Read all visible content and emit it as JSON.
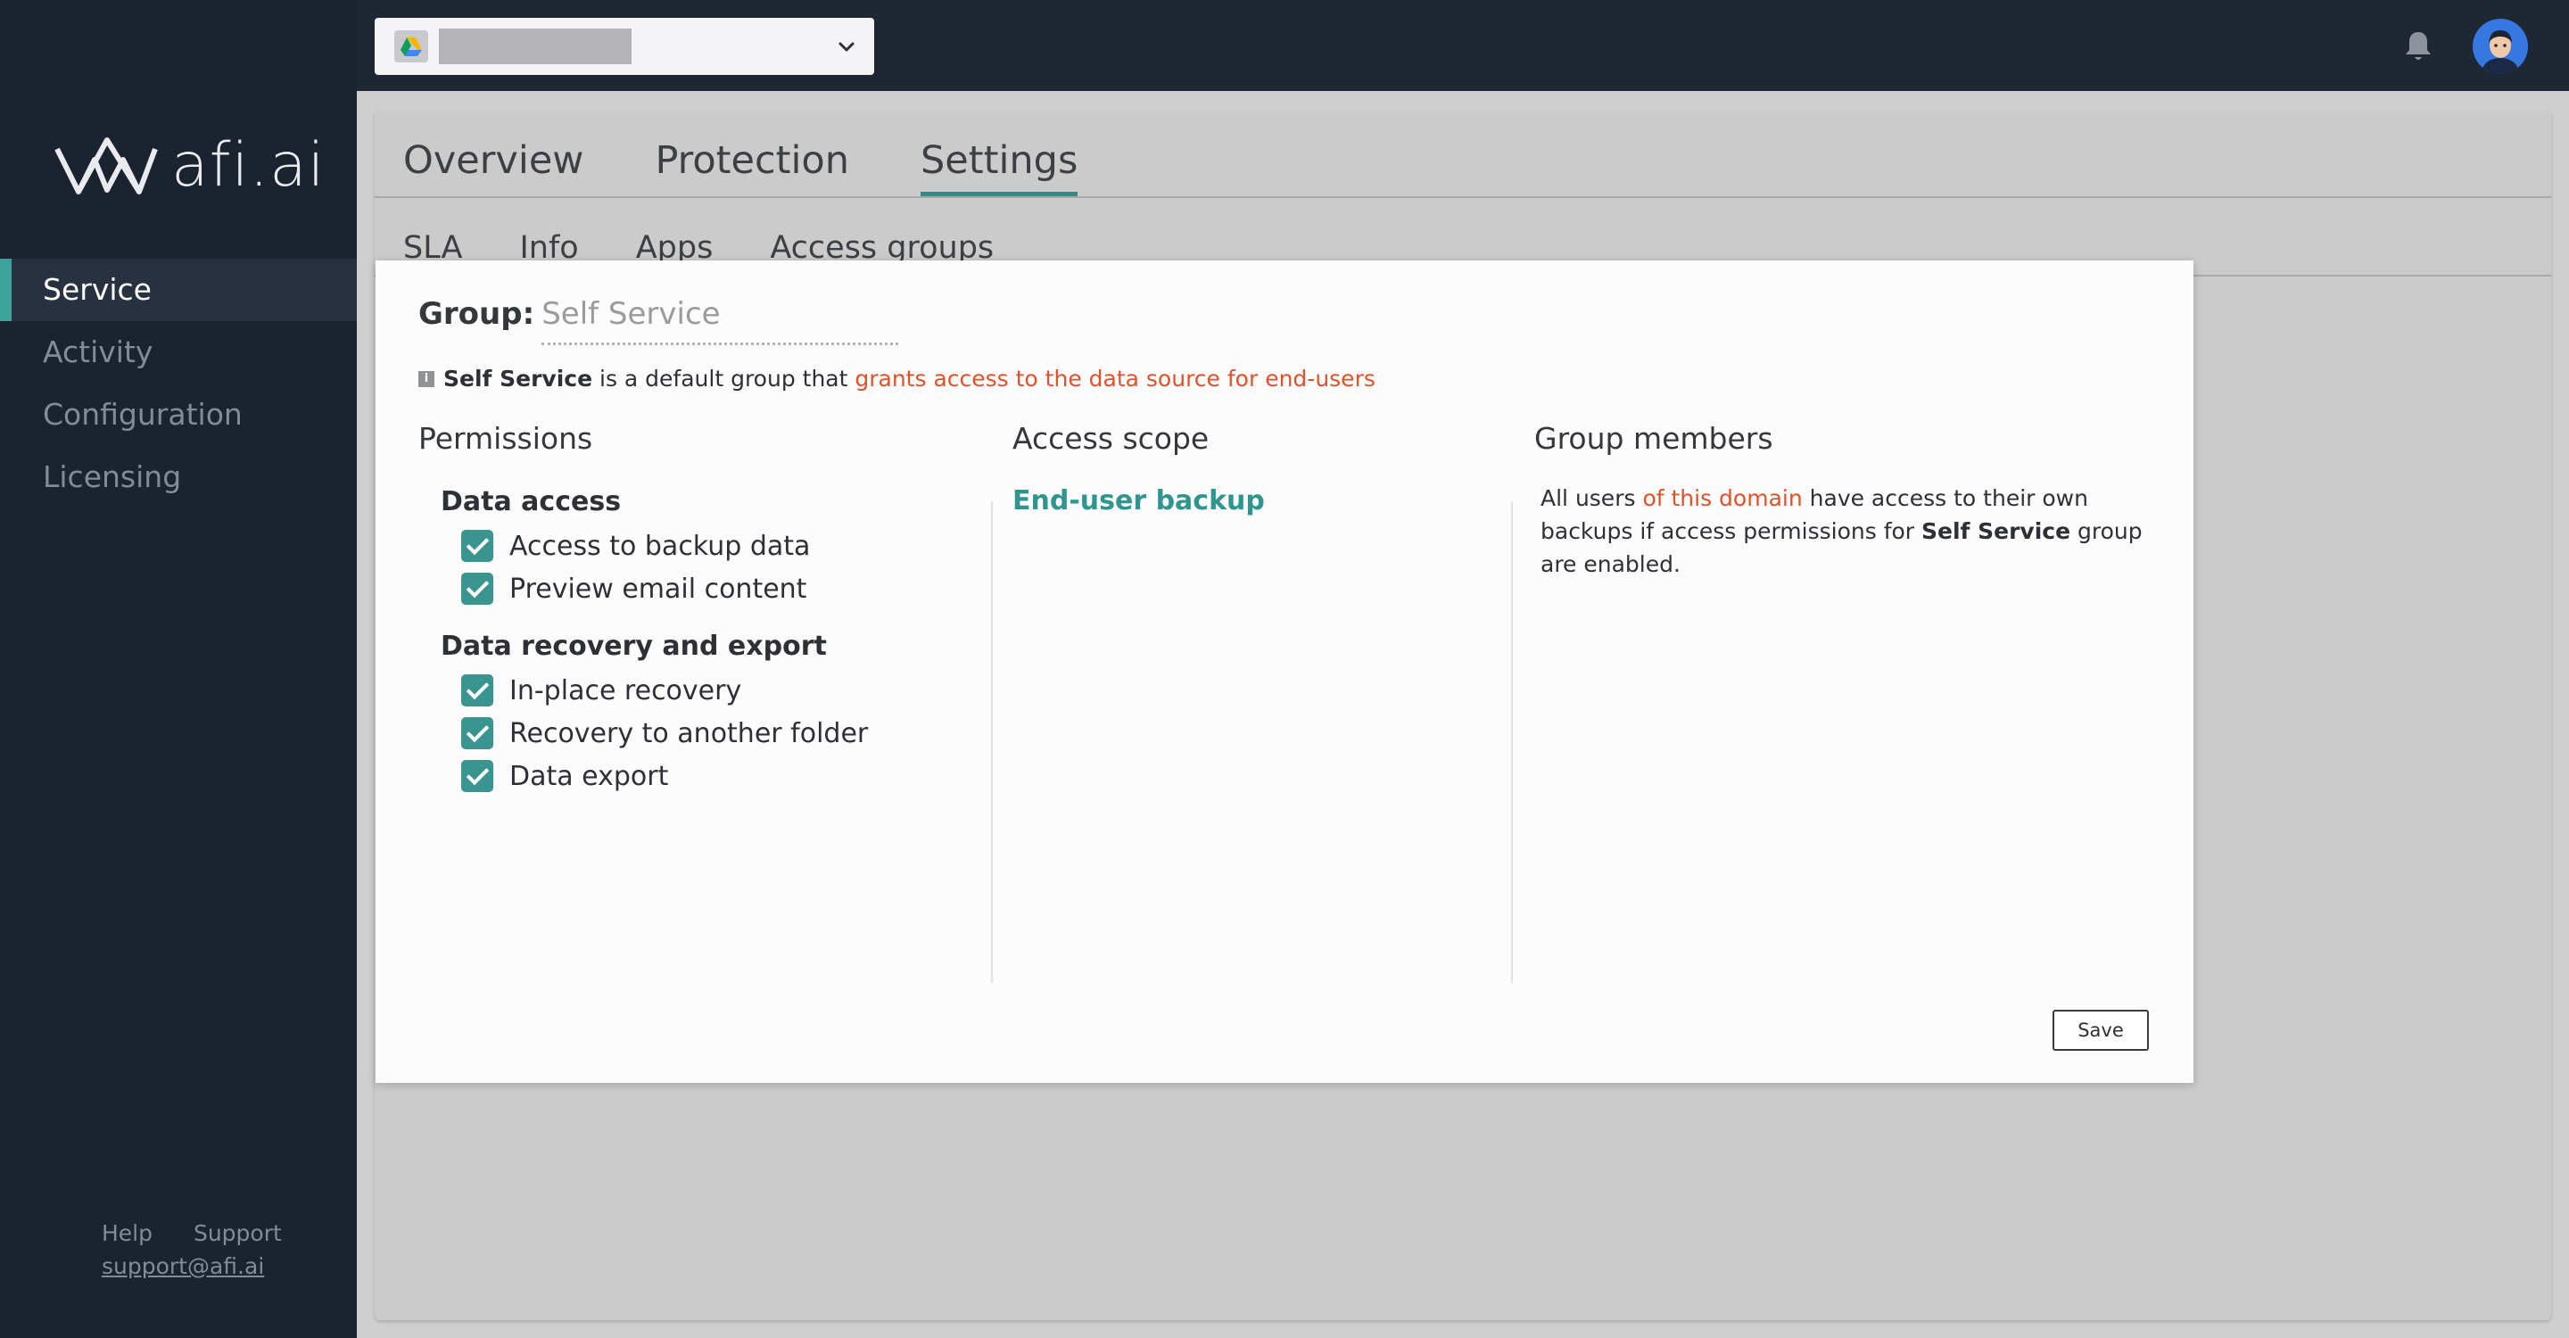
{
  "sidebar": {
    "logo_text": "afi.ai",
    "nav": [
      {
        "label": "Service",
        "active": true
      },
      {
        "label": "Activity",
        "active": false
      },
      {
        "label": "Configuration",
        "active": false
      },
      {
        "label": "Licensing",
        "active": false
      }
    ],
    "footer": {
      "help": "Help",
      "support": "Support",
      "email": "support@afi.ai"
    }
  },
  "topbar": {
    "org_icon": "google-drive-icon",
    "org_name": "",
    "dropdown_icon": "chevron-down-icon",
    "bell_icon": "bell-icon",
    "avatar": "user-avatar"
  },
  "tabs": [
    {
      "label": "Overview",
      "active": false
    },
    {
      "label": "Protection",
      "active": false
    },
    {
      "label": "Settings",
      "active": true
    }
  ],
  "subtabs": [
    {
      "label": "SLA"
    },
    {
      "label": "Info"
    },
    {
      "label": "Apps"
    },
    {
      "label": "Access groups"
    }
  ],
  "modal": {
    "group_label": "Group:",
    "group_name": "Self Service",
    "desc_strong": "Self Service",
    "desc_mid": " is a default group that ",
    "desc_accent": "grants access to the data source for end-users",
    "permissions_title": "Permissions",
    "data_access_title": "Data access",
    "data_access_items": [
      {
        "label": "Access to backup data",
        "checked": true
      },
      {
        "label": "Preview email content",
        "checked": true
      }
    ],
    "recovery_title": "Data recovery and export",
    "recovery_items": [
      {
        "label": "In-place recovery",
        "checked": true
      },
      {
        "label": "Recovery to another folder",
        "checked": true
      },
      {
        "label": "Data export",
        "checked": true
      }
    ],
    "access_scope_title": "Access scope",
    "access_scope_link": "End-user backup",
    "group_members_title": "Group members",
    "members_text_1": "All users ",
    "members_text_accent": "of this domain",
    "members_text_2": " have access to their own backups if access permissions for ",
    "members_text_strong": "Self Service",
    "members_text_3": " group are enabled.",
    "save_label": "Save"
  },
  "colors": {
    "accent_teal": "#3a9490",
    "accent_orange": "#e1522a",
    "sidebar_bg": "#1b2230",
    "topbar_bg": "#1f2735"
  }
}
